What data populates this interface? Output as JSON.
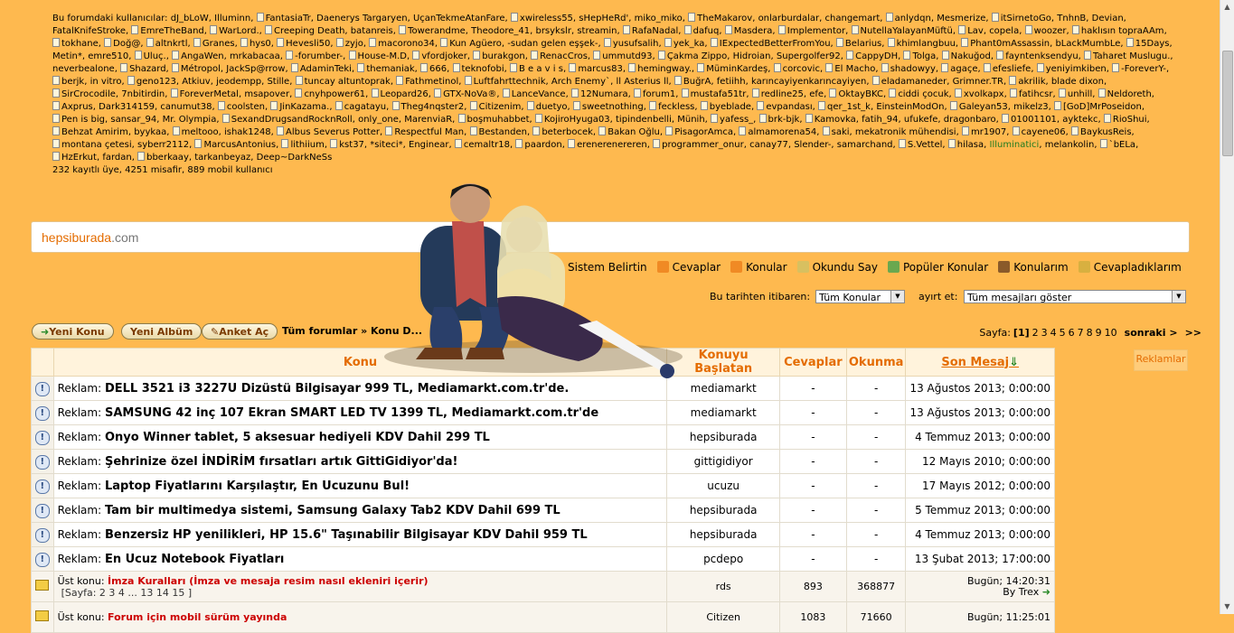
{
  "online": {
    "intro": "Bu forumdaki kullanıcılar:",
    "users": [
      "dJ_bLoW",
      "Illuminn",
      "FantasiaTr",
      "Daenerys Targaryen",
      "UçanTekmeAtanFare",
      "xwireless55",
      "sHepHeRd'",
      "miko_miko",
      "TheMakarov",
      "onlarburdalar",
      "changemart",
      "anlydqn",
      "Mesmerize",
      "itSirnetoGo",
      "TnhnB",
      "Devian",
      "FatalKnifeStroke",
      "EmreTheBand",
      "WarLord.",
      "Creeping Death",
      "batanreis",
      "Towerandme",
      "Theodore_41",
      "brsykslr",
      "streamin",
      "RafaNadal",
      "dafuq",
      "Masdera",
      "Implementor",
      "NutellaYalayanMüftü",
      "Lav",
      "copela",
      "woozer",
      "haklısın topraAAm",
      "tokhane",
      "Doğ@",
      "altnkrtl",
      "Granes",
      "hys0",
      "Hevesli50",
      "zyjo",
      "macorono34",
      "Kun Agüero",
      "-sudan gelen eşşek-",
      "yusufsalih",
      "yek_ka",
      "IExpectedBetterFromYou",
      "Belarius",
      "khimlangbuu",
      "Phant0mAssassin",
      "bLackMumbLe",
      "15Days",
      "Metin*",
      "emre510",
      "Uluç.",
      "AngaWen",
      "mrkabacaa",
      "-forumber-",
      "House-M.D",
      "vfordjoker",
      "burakgon",
      "RenacCros",
      "ummutd93",
      "Çakma Zippo",
      "Hidroian",
      "Supergolfer92",
      "CappyDH",
      "Tolga",
      "Nakuğod",
      "fayntenksendyu",
      "Taharet Muslugu.",
      "neverbealone",
      "Shazard",
      "Métropol",
      "JackSp@rrow",
      "AdaminTeki",
      "themaniak",
      "666",
      "teknofobi",
      "B e a v i s",
      "marcus83",
      "hemingway.",
      "MüminKardeş",
      "corcovic",
      "El Macho",
      "shadowyy",
      "agaçe",
      "efesliefe",
      "yeniyimkiben",
      "-ForeverY-",
      "berjk",
      "in vitro",
      "geno123",
      "Atkiuv",
      "jeodempp",
      "Stille",
      "tuncay altuntoprak",
      "Fathmetinol",
      "Luftfahrttechnik",
      "Arch Enemy`",
      "ll Asterius ll",
      "BuğrA",
      "fetiihh",
      "karıncayiyenkarıncayiyen",
      "eladamaneder",
      "Grimner.TR",
      "akrilik",
      "blade dixon",
      "SirCrocodile",
      "7nbitirdin",
      "ForeverMetal",
      "msapover",
      "cnyhpower61",
      "Leopard26",
      "GTX-NoVa®",
      "LanceVance",
      "12Numara",
      "forum1",
      "mustafa51tr",
      "redline25",
      "efe",
      "OktayBKC",
      "ciddi çocuk",
      "xvolkapx",
      "fatihcsr",
      "unhill",
      "Neldoreth",
      "Axprus",
      "Dark314159",
      "canumut38",
      "coolsten",
      "JinKazama.",
      "cagatayu",
      "Theg4nqster2",
      "Citizenim",
      "duetyo",
      "sweetnothing",
      "feckless",
      "byeblade",
      "evpandası",
      "qer_1st_k",
      "EinsteinModOn",
      "Galeyan53",
      "mikelz3",
      "[GoD]MrPoseidon",
      "Pen is big",
      "sansar_94",
      "Mr. Olympia",
      "SexandDrugsandRocknRoll",
      "only_one",
      "MarenviaR",
      "boşmuhabbet",
      "KojiroHyuga03",
      "tipindenbelli",
      "Münih",
      "yafess_",
      "brk-bjk",
      "Kamovka",
      "fatih_94",
      "ufukefe",
      "dragonbaro",
      "01001101",
      "ayktekc",
      "RioShui",
      "Behzat Amirim",
      "byykaa",
      "meltooo",
      "ishak1248",
      "Albus Severus Potter",
      "Respectful Man",
      "Bestanden",
      "beterbocek",
      "Bakan Oğlu",
      "PisagorAmca",
      "almamorena54",
      "saki",
      "mekatronik mühendisi",
      "mr1907",
      "cayene06",
      "BaykusReis",
      "montana çetesi",
      "syberr2112",
      "MarcusAntonius",
      "lithiium",
      "kst37",
      "*siteci*",
      "Enginear",
      "cemaltr18",
      "paardon",
      "erenerenereren",
      "programmer_onur",
      "canay77",
      "Slender-",
      "samarchand",
      "S.Vettel",
      "hilasa",
      "Illuminatici",
      "melankolin",
      "`bELa",
      "HzErkut",
      "fardan",
      "bberkaay",
      "tarkanbeyaz",
      "Deep~DarkNeSs"
    ],
    "plain_users": [
      "dJ_bLoW",
      "Illuminn",
      "Daenerys Targaryen",
      "UçanTekmeAtanFare",
      "sHepHeRd'",
      "miko_miko",
      "onlarburdalar",
      "changemart",
      "Mesmerize",
      "TnhnB",
      "Devian",
      "FatalKnifeStroke",
      "batanreis",
      "Theodore_41",
      "brsykslr",
      "streamin",
      "copela",
      "-sudan gelen eşşek-",
      "bLackMumbLe",
      "Metin*",
      "emre510",
      "mrkabacaa",
      "Hidroian",
      "Supergolfer92",
      "neverbealone",
      "JackSp@rrow",
      "in vitro",
      "Atkiuv",
      "jeodempp",
      "Stille",
      "Arch Enemy`",
      "ll Asterius ll",
      "fetiihh",
      "karıncayiyenkarıncayiyen",
      "Grimner.TR",
      "blade dixon",
      "7nbitirdin",
      "msapover",
      "efe",
      "Dark314159",
      "canumut38",
      "EinsteinModOn",
      "sansar_94",
      "Mr. Olympia",
      "only_one",
      "MarenviaR",
      "tipindenbelli",
      "Münih",
      "fatih_94",
      "ufukefe",
      "dragonbaro",
      "ayktekc",
      "byykaa",
      "ishak1248",
      "mekatronik mühendisi",
      "syberr2112",
      "*siteci*",
      "canay77",
      "Slender-",
      "samarchand",
      "melankolin",
      "fardan",
      "tarkanbeyaz",
      "Deep~DarkNeSs",
      "Illuminatici",
      "mikelz3",
      "Enginear",
      "Stille"
    ],
    "green_user": "Illuminatici",
    "summary": "232 kayıtlı üye, 4251 misafir, 889 mobil kullanıcı"
  },
  "ad_logo": {
    "part1": "hepsiburada",
    "part2": ".com"
  },
  "toolbar": [
    {
      "label": "Sistem Belirtin",
      "icon": "none",
      "color": "transparent"
    },
    {
      "label": "Cevaplar",
      "icon": "rss-icon",
      "color": "#f08a24"
    },
    {
      "label": "Konular",
      "icon": "rss-icon",
      "color": "#f08a24"
    },
    {
      "label": "Okundu Say",
      "icon": "checklist-icon",
      "color": "#d8c060"
    },
    {
      "label": "Popüler Konular",
      "icon": "chart-icon",
      "color": "#6aa84f"
    },
    {
      "label": "Konularım",
      "icon": "topics-icon",
      "color": "#8a5a2a"
    },
    {
      "label": "Cevapladıklarım",
      "icon": "pencil-icon",
      "color": "#d8b040"
    }
  ],
  "filters": {
    "date_label": "Bu tarihten itibaren:",
    "date_value": "Tüm Konular",
    "sort_label": "ayırt et:",
    "sort_value": "Tüm mesajları göster"
  },
  "buttons": {
    "new_topic": "Yeni Konu",
    "new_album": "Yeni Albüm",
    "poll": "Anket  Aç"
  },
  "breadcrumb": "Tüm forumlar » Konu D...",
  "pager": {
    "label": "Sayfa:",
    "current": "[1]",
    "pages": [
      "2",
      "3",
      "4",
      "5",
      "6",
      "7",
      "8",
      "9",
      "10"
    ],
    "next": "sonraki >",
    "last": ">>"
  },
  "side_ad": "Reklamlar",
  "table": {
    "headers": {
      "topic": "Konu",
      "starter": "Konuyu Başlatan",
      "replies": "Cevaplar",
      "views": "Okunma",
      "last": "Son Mesaj"
    },
    "ads": [
      {
        "prefix": "Reklam:",
        "title": "DELL 3521 i3 3227U Dizüstü Bilgisayar 999 TL, Mediamarkt.com.tr'de.",
        "starter": "mediamarkt",
        "replies": "-",
        "views": "-",
        "last": "13 Ağustos 2013; 0:00:00"
      },
      {
        "prefix": "Reklam:",
        "title": "SAMSUNG 42 inç 107 Ekran SMART LED TV 1399 TL, Mediamarkt.com.tr'de",
        "starter": "mediamarkt",
        "replies": "-",
        "views": "-",
        "last": "13 Ağustos 2013; 0:00:00"
      },
      {
        "prefix": "Reklam:",
        "title": "Onyo Winner tablet, 5 aksesuar hediyeli KDV Dahil 299 TL",
        "starter": "hepsiburada",
        "replies": "-",
        "views": "-",
        "last": "4 Temmuz 2013; 0:00:00"
      },
      {
        "prefix": "Reklam:",
        "title": "Şehrinize özel İNDİRİM fırsatları artık GittiGidiyor'da!",
        "starter": "gittigidiyor",
        "replies": "-",
        "views": "-",
        "last": "12 Mayıs 2010; 0:00:00"
      },
      {
        "prefix": "Reklam:",
        "title": "Laptop Fiyatlarını Karşılaştır, En Ucuzunu Bul!",
        "starter": "ucuzu",
        "replies": "-",
        "views": "-",
        "last": "17 Mayıs 2012; 0:00:00"
      },
      {
        "prefix": "Reklam:",
        "title": "Tam bir multimedya sistemi, Samsung Galaxy Tab2 KDV Dahil 699 TL",
        "starter": "hepsiburada",
        "replies": "-",
        "views": "-",
        "last": "5 Temmuz 2013; 0:00:00"
      },
      {
        "prefix": "Reklam:",
        "title": "Benzersiz HP yenilikleri, HP 15.6\" Taşınabilir Bilgisayar KDV Dahil 959 TL",
        "starter": "hepsiburada",
        "replies": "-",
        "views": "-",
        "last": "4 Temmuz 2013; 0:00:00"
      },
      {
        "prefix": "Reklam:",
        "title": "En Ucuz Notebook Fiyatları",
        "starter": "pcdepo",
        "replies": "-",
        "views": "-",
        "last": "13 Şubat 2013; 17:00:00"
      }
    ],
    "sticky": [
      {
        "prefix": "Üst konu:",
        "title": "İmza Kuralları (İmza ve mesaja resim nasıl ekleniri içerir)",
        "pages": "[Sayfa: 2 3 4 ... 13 14 15 ]",
        "starter": "rds",
        "replies": "893",
        "views": "368877",
        "last_time": "Bugün; 14:20:31",
        "last_by": "By Trex"
      },
      {
        "prefix": "Üst konu:",
        "title": "Forum için mobil sürüm yayında",
        "pages": "",
        "starter": "Citizen",
        "replies": "1083",
        "views": "71660",
        "last_time": "Bugün; 11:25:01",
        "last_by": ""
      }
    ]
  }
}
